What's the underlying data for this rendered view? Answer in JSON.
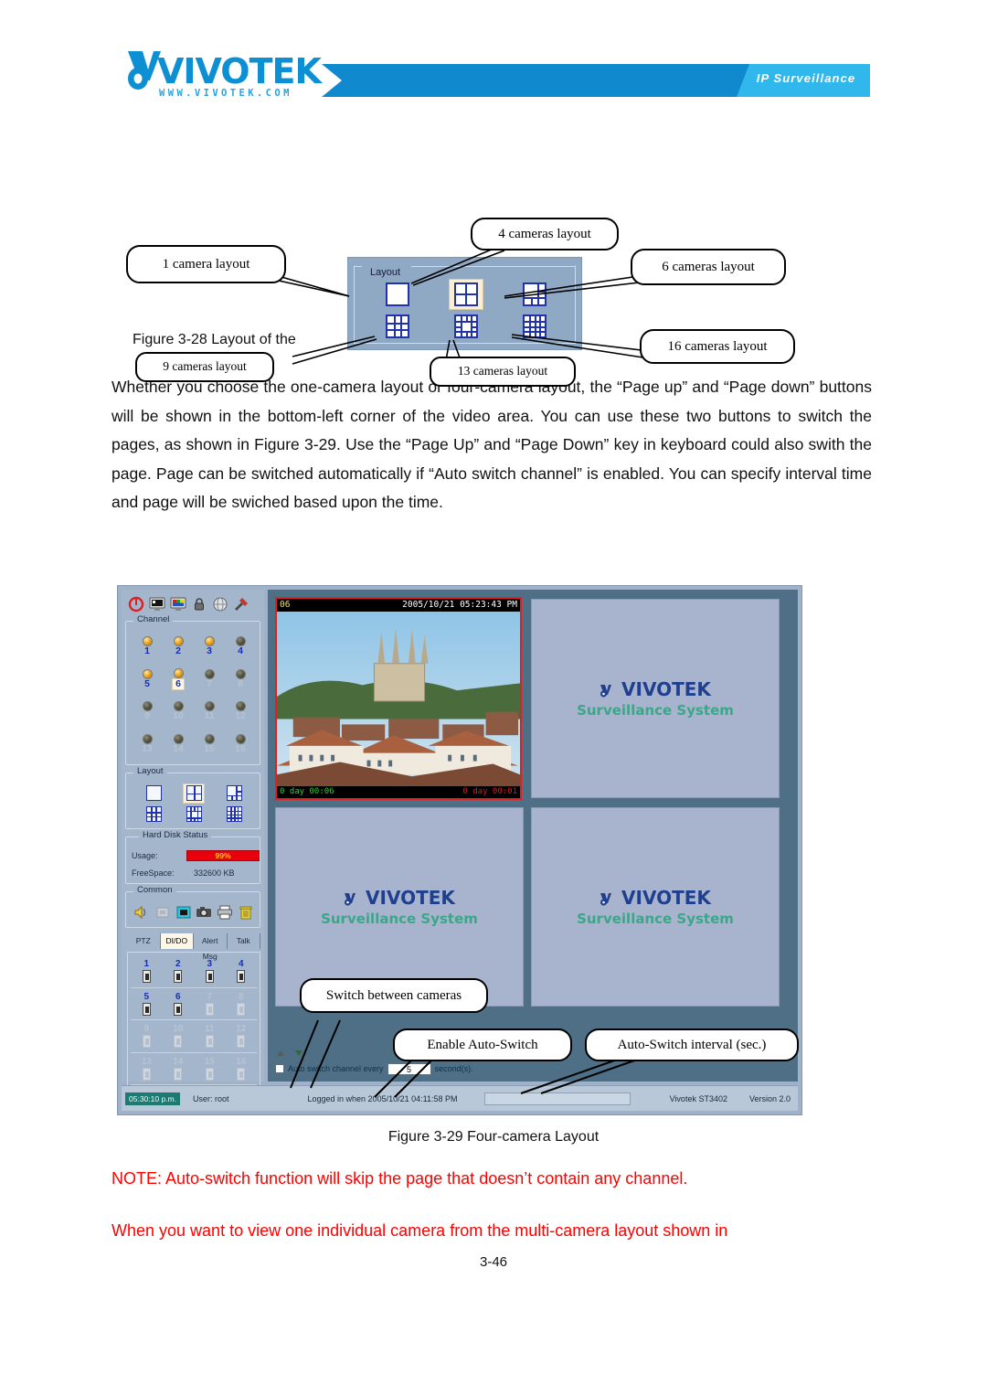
{
  "header": {
    "logo_word": "VIVOTEK",
    "logo_url": "WWW.VIVOTEK.COM",
    "banner_label": "IP Surveillance"
  },
  "figure328": {
    "panel_legend": "Layout",
    "caption": "Figure 3-28 Layout of the",
    "callouts": [
      {
        "id": "c1",
        "label": "1 camera layout"
      },
      {
        "id": "c4",
        "label": "4 cameras layout"
      },
      {
        "id": "c6",
        "label": "6 cameras layout"
      },
      {
        "id": "c16",
        "label": "16 cameras layout"
      },
      {
        "id": "c9",
        "label": "9 cameras layout"
      },
      {
        "id": "c13",
        "label": "13 cameras layout"
      }
    ],
    "layout_icons": [
      {
        "name": "layout-1-camera",
        "cells": 1,
        "selected": false
      },
      {
        "name": "layout-4-camera",
        "cells": 4,
        "selected": true
      },
      {
        "name": "layout-6-camera",
        "cells": 6,
        "selected": false
      },
      {
        "name": "layout-9-camera",
        "cells": 9,
        "selected": false
      },
      {
        "name": "layout-13-camera",
        "cells": 13,
        "selected": false
      },
      {
        "name": "layout-16-camera",
        "cells": 16,
        "selected": false
      }
    ]
  },
  "body": {
    "paragraph": "Whether you choose the one-camera layout or four-camera layout, the “Page up” and “Page down” buttons will be shown in the bottom-left corner of the video area. You can use these two buttons to switch the pages, as shown in Figure 3-29. Use the “Page Up” and “Page Down” key in keyboard could also swith the page. Page can be switched automatically if “Auto switch channel” is enabled. You can specify interval time and page will be swiched based upon the time."
  },
  "app": {
    "toolbar": [
      {
        "name": "power-icon",
        "title": "Power"
      },
      {
        "name": "monitor-icon",
        "title": "Monitor"
      },
      {
        "name": "display-icon",
        "title": "Display"
      },
      {
        "name": "lock-icon",
        "title": "Lock"
      },
      {
        "name": "network-icon",
        "title": "Network"
      },
      {
        "name": "settings-icon",
        "title": "Settings"
      }
    ],
    "channel": {
      "legend": "Channel",
      "items": [
        {
          "num": "1",
          "on": true,
          "selected": false
        },
        {
          "num": "2",
          "on": true,
          "selected": false
        },
        {
          "num": "3",
          "on": true,
          "selected": false
        },
        {
          "num": "4",
          "on": false,
          "selected": false,
          "active_label": true
        },
        {
          "num": "5",
          "on": true,
          "selected": false
        },
        {
          "num": "6",
          "on": true,
          "selected": true
        },
        {
          "num": "7",
          "on": false,
          "selected": false
        },
        {
          "num": "8",
          "on": false,
          "selected": false
        },
        {
          "num": "9",
          "on": false,
          "selected": false
        },
        {
          "num": "10",
          "on": false,
          "selected": false
        },
        {
          "num": "11",
          "on": false,
          "selected": false
        },
        {
          "num": "12",
          "on": false,
          "selected": false
        },
        {
          "num": "13",
          "on": false,
          "selected": false
        },
        {
          "num": "14",
          "on": false,
          "selected": false
        },
        {
          "num": "15",
          "on": false,
          "selected": false
        },
        {
          "num": "16",
          "on": false,
          "selected": false
        }
      ]
    },
    "layout_panel": {
      "legend": "Layout",
      "icons": [
        {
          "name": "layout-1-camera",
          "cells": 1,
          "selected": false
        },
        {
          "name": "layout-4-camera",
          "cells": 4,
          "selected": true
        },
        {
          "name": "layout-6-camera",
          "cells": 6,
          "selected": false
        },
        {
          "name": "layout-9-camera",
          "cells": 9,
          "selected": false
        },
        {
          "name": "layout-13-camera",
          "cells": 13,
          "selected": false
        },
        {
          "name": "layout-16-camera",
          "cells": 16,
          "selected": false
        }
      ]
    },
    "hard_disk": {
      "legend": "Hard Disk Status",
      "usage_label": "Usage:",
      "usage_value": "99%",
      "usage_percent": 99,
      "freespace_label": "FreeSpace:",
      "freespace_value": "332600 KB"
    },
    "common": {
      "legend": "Common",
      "icons": [
        {
          "name": "speaker-icon",
          "title": "Audio"
        },
        {
          "name": "mute-icon",
          "title": "Mute"
        },
        {
          "name": "record-icon",
          "title": "Record"
        },
        {
          "name": "snapshot-icon",
          "title": "Snapshot"
        },
        {
          "name": "print-icon",
          "title": "Print"
        },
        {
          "name": "trash-icon",
          "title": "Delete"
        }
      ]
    },
    "tabs": [
      {
        "label": "PTZ",
        "active": false
      },
      {
        "label": "DI/DO",
        "active": true
      },
      {
        "label": "Alert Msg",
        "active": false
      },
      {
        "label": "Talk",
        "active": false
      }
    ],
    "dido": [
      {
        "num": "1",
        "on": true
      },
      {
        "num": "2",
        "on": true
      },
      {
        "num": "3",
        "on": true
      },
      {
        "num": "4",
        "on": true
      },
      {
        "num": "5",
        "on": true
      },
      {
        "num": "6",
        "on": true
      },
      {
        "num": "7",
        "on": false
      },
      {
        "num": "8",
        "on": false
      },
      {
        "num": "9",
        "on": false
      },
      {
        "num": "10",
        "on": false
      },
      {
        "num": "11",
        "on": false
      },
      {
        "num": "12",
        "on": false
      },
      {
        "num": "13",
        "on": false
      },
      {
        "num": "14",
        "on": false
      },
      {
        "num": "15",
        "on": false
      },
      {
        "num": "16",
        "on": false
      }
    ],
    "video": {
      "camera_label": "06",
      "timestamp": "2005/10/21 05:23:43 PM",
      "duration_left": "0 day 00:06",
      "duration_right": "0 day 00:01",
      "placeholder_word": "VIVOTEK",
      "placeholder_sub": "Surveillance System"
    },
    "auto_switch": {
      "prefix": "Auto switch channel every",
      "interval": "5",
      "suffix": "second(s).",
      "checked": false
    },
    "status": {
      "clock": "05:30:10 p.m.",
      "user": "User: root",
      "login": "Logged in when 2005/10/21 04:11:58 PM",
      "product": "Vivotek ST3402",
      "version": "Version 2.0"
    },
    "callouts": [
      {
        "id": "sbc",
        "label": "Switch between cameras"
      },
      {
        "id": "eas",
        "label": "Enable Auto-Switch"
      },
      {
        "id": "asi",
        "label": "Auto-Switch interval (sec.)"
      }
    ]
  },
  "figure329": {
    "caption": "Figure 3-29 Four-camera Layout"
  },
  "notes": {
    "note1": "NOTE: Auto-switch function will skip the page that doesn’t contain any channel.",
    "note2": "When you want to view one individual camera from the multi-camera layout shown in"
  },
  "footer": {
    "page": "3-46"
  },
  "colors": {
    "brand_blue": "#0d8fd4",
    "banner_light": "#30b7ec",
    "note_red": "#ff0000",
    "usage_red": "#e8000d",
    "layout_icon_blue": "#2233aa"
  }
}
